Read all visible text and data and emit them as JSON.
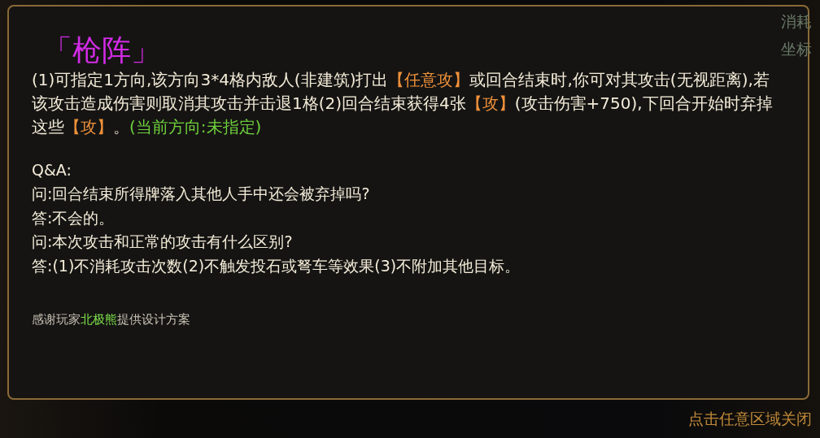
{
  "background": {
    "labels": [
      "消耗",
      "坐标"
    ]
  },
  "tooltip": {
    "title": "「枪阵」",
    "description": [
      {
        "text": "(1)可指定1方向,该方向3*4格内敌人(非建筑)打出",
        "kind": "plain"
      },
      {
        "text": "【任意攻】",
        "kind": "card"
      },
      {
        "text": "或回合结束时,你可对其攻击(无视距离),若该攻击造成伤害则取消其攻击并击退1格(2)回合结束获得4张",
        "kind": "plain"
      },
      {
        "text": "【攻】",
        "kind": "card"
      },
      {
        "text": "(攻击伤害+750),下回合开始时弃掉这些",
        "kind": "plain"
      },
      {
        "text": "【攻】",
        "kind": "card"
      },
      {
        "text": "。",
        "kind": "plain"
      },
      {
        "text": "(当前方向:未指定)",
        "kind": "status"
      }
    ],
    "qa_heading": "Q&A:",
    "qa": [
      "问:回合结束所得牌落入其他人手中还会被弃掉吗?",
      "答:不会的。",
      "问:本次攻击和正常的攻击有什么区别?",
      "答:(1)不消耗攻击次数(2)不触发投石或弩车等效果(3)不附加其他目标。"
    ],
    "credit": [
      {
        "text": "感谢玩家",
        "kind": "plain"
      },
      {
        "text": "北极熊",
        "kind": "player"
      },
      {
        "text": "提供设计方案",
        "kind": "plain"
      }
    ]
  },
  "close_hint": "点击任意区域关闭"
}
